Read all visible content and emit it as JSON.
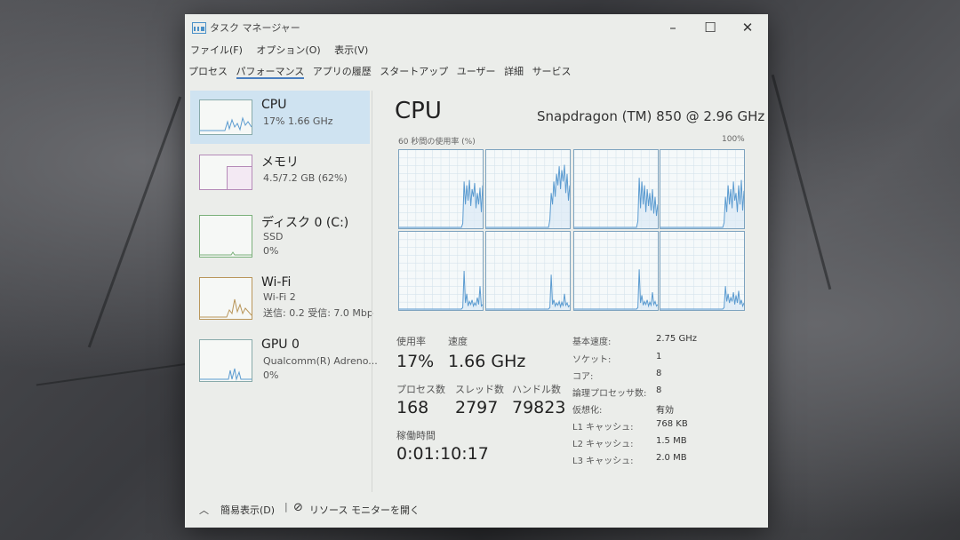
{
  "window": {
    "title": "タスク マネージャー"
  },
  "menu": [
    "ファイル(F)",
    "オプション(O)",
    "表示(V)"
  ],
  "tabs": [
    "プロセス",
    "パフォーマンス",
    "アプリの履歴",
    "スタートアップ",
    "ユーザー",
    "詳細",
    "サービス"
  ],
  "sidebar": [
    {
      "title": "CPU",
      "sub1": "17%  1.66 GHz",
      "sub2": "",
      "sub3": ""
    },
    {
      "title": "メモリ",
      "sub1": "4.5/7.2 GB (62%)",
      "sub2": "",
      "sub3": ""
    },
    {
      "title": "ディスク 0 (C:)",
      "sub1": "SSD",
      "sub2": "0%",
      "sub3": ""
    },
    {
      "title": "Wi-Fi",
      "sub1": "Wi-Fi 2",
      "sub2": "送信: 0.2  受信: 7.0 Mbp",
      "sub3": ""
    },
    {
      "title": "GPU 0",
      "sub1": "Qualcomm(R) Adreno...",
      "sub2": "0%",
      "sub3": ""
    }
  ],
  "main": {
    "title": "CPU",
    "cpu_name": "Snapdragon (TM) 850 @ 2.96 GHz",
    "graph_label": "60 秒間の使用率 (%)",
    "graph_max": "100%",
    "usage_label": "使用率",
    "usage_value": "17%",
    "speed_label": "速度",
    "speed_value": "1.66 GHz",
    "process_label": "プロセス数",
    "process_value": "168",
    "thread_label": "スレッド数",
    "thread_value": "2797",
    "handle_label": "ハンドル数",
    "handle_value": "79823",
    "uptime_label": "稼働時間",
    "uptime_value": "0:01:10:17"
  },
  "specs": [
    {
      "key": "基本速度:",
      "value": "2.75 GHz"
    },
    {
      "key": "ソケット:",
      "value": "1"
    },
    {
      "key": "コア:",
      "value": "8"
    },
    {
      "key": "論理プロセッサ数:",
      "value": "8"
    },
    {
      "key": "仮想化:",
      "value": "有効"
    },
    {
      "key": "L1 キャッシュ:",
      "value": "768 KB"
    },
    {
      "key": "L2 キャッシュ:",
      "value": "1.5 MB"
    },
    {
      "key": "L3 キャッシュ:",
      "value": "2.0 MB"
    }
  ],
  "footer": {
    "collapse_label": "簡易表示(D)",
    "resmon_label": "リソース モニターを開く"
  },
  "colors": {
    "accent": "#4a90c8",
    "graph_line": "#5b9bd0",
    "selected": "#cfe3f1"
  }
}
